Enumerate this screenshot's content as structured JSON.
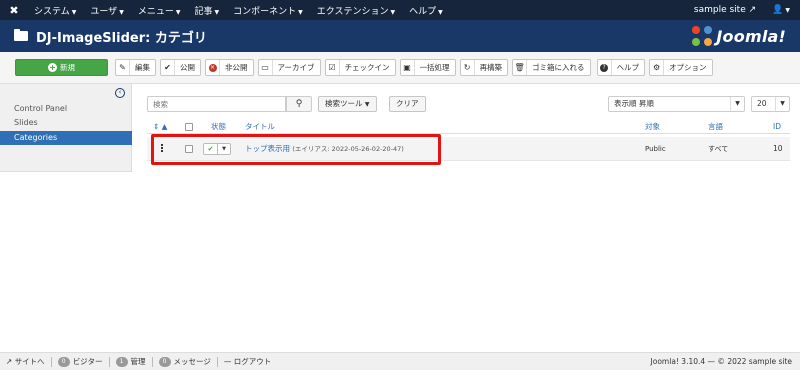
{
  "topnav": {
    "menu": [
      {
        "label": "システム"
      },
      {
        "label": "ユーザ"
      },
      {
        "label": "メニュー"
      },
      {
        "label": "記事"
      },
      {
        "label": "コンポーネント"
      },
      {
        "label": "エクステンション"
      },
      {
        "label": "ヘルプ"
      }
    ],
    "site_label": "sample site"
  },
  "header": {
    "title": "DJ-ImageSlider: カテゴリ",
    "logo_text": "Joomla!"
  },
  "toolbar": {
    "buttons": [
      {
        "label": "新規",
        "icon": "plus-icon"
      },
      {
        "label": "編集",
        "icon": "edit-icon"
      },
      {
        "label": "公開",
        "icon": "check-icon"
      },
      {
        "label": "非公開",
        "icon": "unpublish-icon"
      },
      {
        "label": "アーカイブ",
        "icon": "archive-icon"
      },
      {
        "label": "チェックイン",
        "icon": "checkin-icon"
      },
      {
        "label": "一括処理",
        "icon": "batch-icon"
      },
      {
        "label": "再構築",
        "icon": "refresh-icon"
      },
      {
        "label": "ゴミ箱に入れる",
        "icon": "trash-icon"
      },
      {
        "label": "ヘルプ",
        "icon": "question-icon"
      },
      {
        "label": "オプション",
        "icon": "gear-icon"
      }
    ]
  },
  "sidebar": {
    "items": [
      {
        "label": "Control Panel"
      },
      {
        "label": "Slides"
      },
      {
        "label": "Categories"
      }
    ]
  },
  "filters": {
    "search_placeholder": "検索",
    "search_tools_label": "検索ツール",
    "clear_label": "クリア",
    "sort_value": "表示順 昇順",
    "limit_value": "20"
  },
  "table": {
    "headers": {
      "status": "状態",
      "title": "タイトル",
      "access": "対象",
      "language": "言語",
      "id": "ID"
    },
    "rows": [
      {
        "title": "トップ表示用",
        "alias": "(エイリアス: 2022-05-26-02-20-47)",
        "access": "Public",
        "language": "すべて",
        "id": "10"
      }
    ]
  },
  "footer": {
    "view_site": "サイトへ",
    "visitors_count": "0",
    "visitors_label": "ビジター",
    "admins_count": "1",
    "admins_label": "管理",
    "messages_count": "0",
    "messages_label": "メッセージ",
    "logout_label": "ログアウト",
    "copyright": "Joomla! 3.10.4 — © 2022 sample site"
  },
  "colors": {
    "topnav_bg": "#17253c",
    "header_bg": "#1a3867",
    "new_button": "#46a546",
    "active_nav": "#2f6fb5",
    "highlight": "#e11414"
  }
}
